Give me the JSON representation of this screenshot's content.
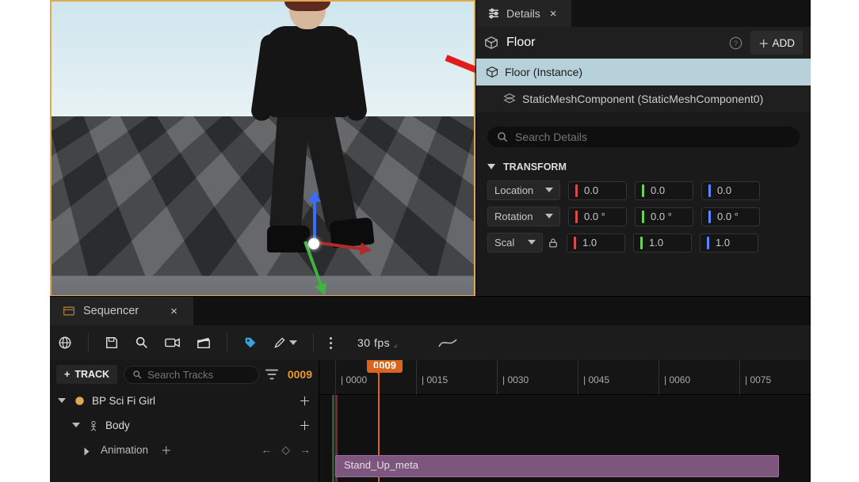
{
  "details": {
    "tab_label": "Details",
    "actor": "Floor",
    "add_label": "ADD",
    "component_root": "Floor (Instance)",
    "component_child": "StaticMeshComponent (StaticMeshComponent0)",
    "search_placeholder": "Search Details",
    "section_transform": "TRANSFORM",
    "location_label": "Location",
    "rotation_label": "Rotation",
    "scale_label": "Scal",
    "location": {
      "x": "0.0",
      "y": "0.0",
      "z": "0.0"
    },
    "rotation": {
      "x": "0.0 °",
      "y": "0.0 °",
      "z": "0.0 °"
    },
    "scale": {
      "x": "1.0",
      "y": "1.0",
      "z": "1.0"
    }
  },
  "sequencer": {
    "tab_label": "Sequencer",
    "fps_label": "30 fps",
    "track_button": "TRACK",
    "track_add_prefix": "+",
    "search_placeholder": "Search Tracks",
    "current_frame": "0009",
    "playhead_label": "0009",
    "ticks": [
      "0000",
      "0015",
      "0030",
      "0045",
      "0060",
      "0075"
    ],
    "tracks": {
      "root": "BP Sci Fi Girl",
      "body": "Body",
      "anim": "Animation"
    },
    "clip_name": "Stand_Up_meta"
  }
}
